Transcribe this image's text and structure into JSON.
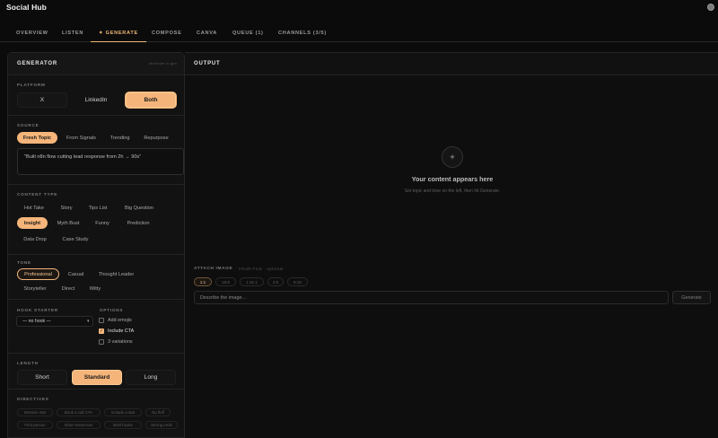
{
  "app": {
    "title": "Social Hub"
  },
  "tabs": [
    {
      "label": "OVERVIEW",
      "active": false
    },
    {
      "label": "LISTEN",
      "active": false
    },
    {
      "label": "✦ GENERATE",
      "active": true
    },
    {
      "label": "COMPOSE",
      "active": false
    },
    {
      "label": "CANVA",
      "active": false
    },
    {
      "label": "QUEUE (1)",
      "active": false
    },
    {
      "label": "CHANNELS (3/5)",
      "active": false
    }
  ],
  "generator": {
    "title": "GENERATOR",
    "hint": "ctrl+enter to gen",
    "platform": {
      "label": "PLATFORM",
      "options": [
        "X",
        "LinkedIn",
        "Both"
      ],
      "selected": "Both"
    },
    "source": {
      "label": "SOURCE",
      "options": [
        "Fresh Topic",
        "From Signals",
        "Trending",
        "Repurpose"
      ],
      "selected": "Fresh Topic",
      "text": "\"Built n8n flow cutting lead response from 2h → 90s\""
    },
    "content_type": {
      "label": "CONTENT TYPE",
      "options": [
        "Hot Take",
        "Story",
        "Tips List",
        "Big Question",
        "Insight",
        "Myth Bust",
        "Funny",
        "Prediction",
        "Data Drop",
        "Case Study"
      ],
      "selected": "Insight"
    },
    "tone": {
      "label": "TONE",
      "options": [
        "Professional",
        "Casual",
        "Thought Leader",
        "Storyteller",
        "Direct",
        "Witty"
      ],
      "selected": "Professional"
    },
    "hook_starter": {
      "label": "HOOK STARTER",
      "value": "— no hook —"
    },
    "options": {
      "label": "OPTIONS",
      "items": [
        {
          "label": "Add emojis",
          "checked": false
        },
        {
          "label": "Include CTA",
          "checked": true
        },
        {
          "label": "3 variations",
          "checked": false
        }
      ]
    },
    "length": {
      "label": "LENGTH",
      "options": [
        "Short",
        "Standard",
        "Long"
      ],
      "selected": "Standard"
    },
    "directives": {
      "label": "DIRECTIVES",
      "items": [
        "Mention n8n",
        "Book a call CTA",
        "Include a stat",
        "No fluff",
        "First person",
        "Short sentences",
        "Bold hooks",
        "Strong ends"
      ]
    }
  },
  "output": {
    "title": "OUTPUT",
    "empty_title": "Your content appears here",
    "empty_sub": "Set topic and tone on the left, then hit Generate.",
    "attach": {
      "label": "ATTACH IMAGE",
      "sub": "· YOUR FILE · optional",
      "ratios": [
        "1:1",
        "16:9",
        "1.91:1",
        "4:5",
        "9:16"
      ],
      "selected": "1:1",
      "placeholder": "Describe the image…",
      "button": "Generate"
    }
  }
}
